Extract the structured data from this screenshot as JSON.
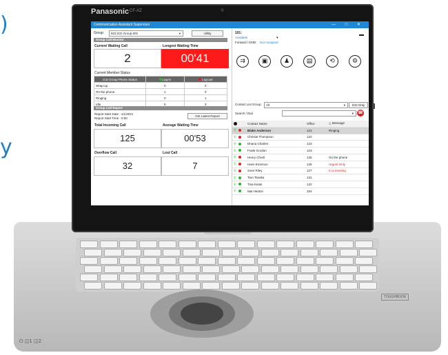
{
  "laptop": {
    "brand": "Panasonic",
    "model": "CF-XZ",
    "badge": "TOUGHBOOK",
    "indicators": "⏻ ◫1 ◫2"
  },
  "decor": {
    "glyph_top": ")",
    "glyph_mid": "y"
  },
  "app": {
    "title": "Communication Assistant Supervisor",
    "window_controls": "— □ ✕",
    "group_label": "Group",
    "group_value": "602:ICD Group 602",
    "utility_button": "Utility",
    "status": {
      "extension": "101:",
      "state": "Available",
      "forward_dnd_label": "Forward / DND:",
      "forward_dnd_value": "Not Assigned"
    },
    "group_call_monitor": {
      "section_title": "Group Call Monitor",
      "current_waiting_label": "Current Waiting Call",
      "current_waiting_value": "2",
      "longest_waiting_label": "Longest Waiting Time",
      "longest_waiting_value": "00'41"
    },
    "current_member_status": {
      "title": "Current Member Status",
      "col_head": "ICD Group Phone Status",
      "col_login": "Log-in",
      "col_logout": "Log-out",
      "rows": [
        {
          "label": "Wrap-up",
          "login": "0",
          "logout": "0"
        },
        {
          "label": "On the phone",
          "login": "1",
          "logout": "0"
        },
        {
          "label": "Ringing",
          "login": "0",
          "logout": "1"
        },
        {
          "label": "Idle",
          "login": "5",
          "logout": "3"
        }
      ]
    },
    "group_call_report": {
      "section_title": "Group Call Report",
      "start_date": "Report Start Date : 1/1/2021",
      "start_time": "Report Start Time : 0:00",
      "latest_button": "Get Latest Report",
      "total_incoming_label": "Total Incoming Call",
      "total_incoming_value": "125",
      "avg_waiting_label": "Average Waiting Time",
      "avg_waiting_value": "00'53",
      "overflow_label": "Overflow Call",
      "overflow_value": "32",
      "lost_label": "Lost Call",
      "lost_value": "7"
    },
    "toolbar_icons": [
      "call-transfer-icon",
      "directory-icon",
      "group-icon",
      "contacts-icon",
      "history-icon",
      "settings-icon"
    ],
    "contact_list": {
      "group_label": "Contact List Group:",
      "group_value": "All",
      "icd_only_button": "ICD Only",
      "search_label": "Search / Dial",
      "col_name": "Contact Name",
      "col_office": "Office",
      "col_message": "Message",
      "rows": [
        {
          "name": "Blake Anderson",
          "office": "121",
          "message": "Ringing",
          "status_color": "#e02020",
          "selected": true,
          "msg_color": "#222222"
        },
        {
          "name": "Christie Thompson",
          "office": "122",
          "message": "",
          "status_color": "#e02020",
          "selected": false,
          "msg_color": "#222222"
        },
        {
          "name": "Dhana Charles",
          "office": "123",
          "message": "",
          "status_color": "#2cb52c",
          "selected": false,
          "msg_color": "#222222"
        },
        {
          "name": "Frank Gordon",
          "office": "124",
          "message": "",
          "status_color": "#2cb52c",
          "selected": false,
          "msg_color": "#222222"
        },
        {
          "name": "Henry Chrell",
          "office": "125",
          "message": "On the phone",
          "status_color": "#e02020",
          "selected": false,
          "msg_color": "#222222"
        },
        {
          "name": "Hans Emerson",
          "office": "126",
          "message": "Urgent Only",
          "status_color": "#e02020",
          "selected": false,
          "msg_color": "#e02020"
        },
        {
          "name": "Sven Riley",
          "office": "127",
          "message": "In a meeting",
          "status_color": "#e02020",
          "selected": false,
          "msg_color": "#e02020"
        },
        {
          "name": "Taro Tanaka",
          "office": "131",
          "message": "",
          "status_color": "#2cb52c",
          "selected": false,
          "msg_color": "#222222"
        },
        {
          "name": "Tina Keats",
          "office": "132",
          "message": "",
          "status_color": "#2cb52c",
          "selected": false,
          "msg_color": "#222222"
        },
        {
          "name": "Mai Heaton",
          "office": "154",
          "message": "",
          "status_color": "#2cb52c",
          "selected": false,
          "msg_color": "#222222"
        }
      ]
    }
  }
}
